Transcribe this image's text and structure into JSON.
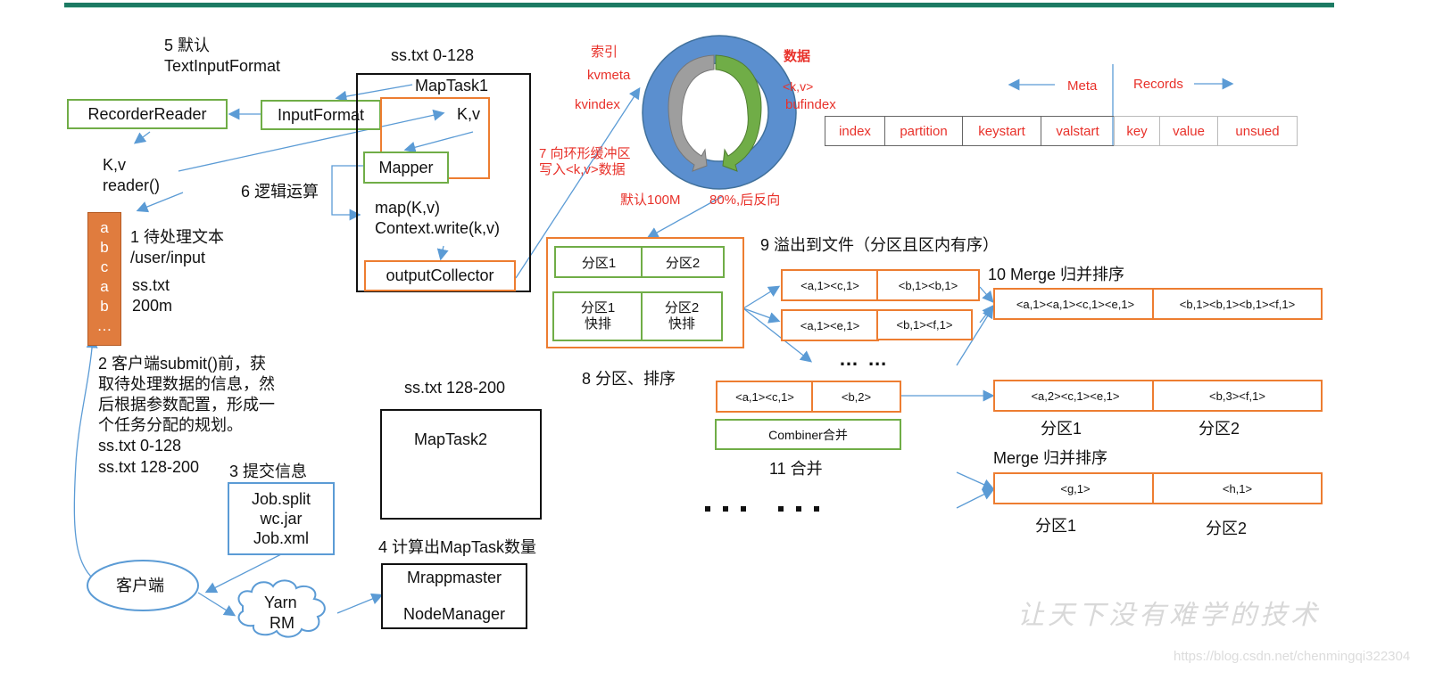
{
  "title_bar_color": "#1c7a63",
  "colors": {
    "green_border": "#70ad47",
    "orange_border": "#ed7d31",
    "blue_arrow": "#5b9bd5",
    "red_text": "#e8312a",
    "ring_blue": "#5b8fcf"
  },
  "left": {
    "step5_line1": "5 默认",
    "step5_line2": "TextInputFormat",
    "recorder_reader": "RecorderReader",
    "input_format": "InputFormat",
    "kv_label": "K,v",
    "reader_label": "reader()",
    "step6": "6 逻辑运算",
    "file_letters": [
      "a",
      "b",
      "c",
      "a",
      "b",
      "…"
    ],
    "step1_line1": "1 待处理文本",
    "step1_line2": "/user/input",
    "file_name": "ss.txt",
    "file_size": "200m",
    "step2_lines": [
      "2 客户端submit()前，获",
      "取待处理数据的信息，然",
      "后根据参数配置，形成一",
      "个任务分配的规划。"
    ],
    "split1": "ss.txt  0-128",
    "split2": "ss.txt  128-200",
    "step3": "3 提交信息",
    "job_files": [
      "Job.split",
      "wc.jar",
      "Job.xml"
    ],
    "client": "客户端",
    "yarn_line1": "Yarn",
    "yarn_line2": "RM",
    "step4": "4 计算出MapTask数量",
    "mrappmaster": "Mrappmaster",
    "nodemanager": "NodeManager"
  },
  "maptask1": {
    "split_label": "ss.txt 0-128",
    "title": "MapTask1",
    "kv": "K,v",
    "mapper": "Mapper",
    "map_call": "map(K,v)",
    "context_write": "Context.write(k,v)",
    "output_collector": "outputCollector"
  },
  "maptask2": {
    "split_label": "ss.txt 128-200",
    "title": "MapTask2"
  },
  "ring_buffer": {
    "index_label": "索引",
    "kvmeta": "kvmeta",
    "kvindex": "kvindex",
    "data_label": "数据",
    "kv": "<k,v>",
    "bufindex": "bufindex",
    "step7_line1": "7 向环形缓冲区",
    "step7_line2": "写入<k,v>数据",
    "default_size": "默认100M",
    "threshold": "80%,后反向"
  },
  "meta_records": {
    "meta_label": "Meta",
    "records_label": "Records",
    "cells": [
      "index",
      "partition",
      "keystart",
      "valstart",
      "key",
      "value",
      "unsued"
    ]
  },
  "partition_sort": {
    "p1": "分区1",
    "p2": "分区2",
    "p1_sort_line1": "分区1",
    "p1_sort_line2": "快排",
    "p2_sort_line1": "分区2",
    "p2_sort_line2": "快排",
    "step8": "8 分区、排序"
  },
  "spill": {
    "step9": "9 溢出到文件（分区且区内有序）",
    "file1": [
      "<a,1><c,1>",
      "<b,1><b,1>"
    ],
    "file2": [
      "<a,1><e,1>",
      "<b,1><f,1>"
    ],
    "ellipsis": "… …"
  },
  "merge": {
    "step10": "10 Merge 归并排序",
    "merged": [
      "<a,1><a,1><c,1><e,1>",
      "<b,1><b,1><b,1><f,1>"
    ],
    "combined": [
      "<a,2><c,1><e,1>",
      "<b,3><f,1>"
    ],
    "part1": "分区1",
    "part2": "分区2",
    "merge2_title": "Merge 归并排序",
    "merge2": [
      "<g,1>",
      "<h,1>"
    ],
    "part1b": "分区1",
    "part2b": "分区2"
  },
  "combiner": {
    "cells": [
      "<a,1><c,1>",
      "<b,2>"
    ],
    "label": "Combiner合并",
    "step11": "11 合并",
    "ellipsis": "… …"
  },
  "watermark": {
    "slogan": "让天下没有难学的技术",
    "url": "https://blog.csdn.net/chenmingqi322304"
  }
}
